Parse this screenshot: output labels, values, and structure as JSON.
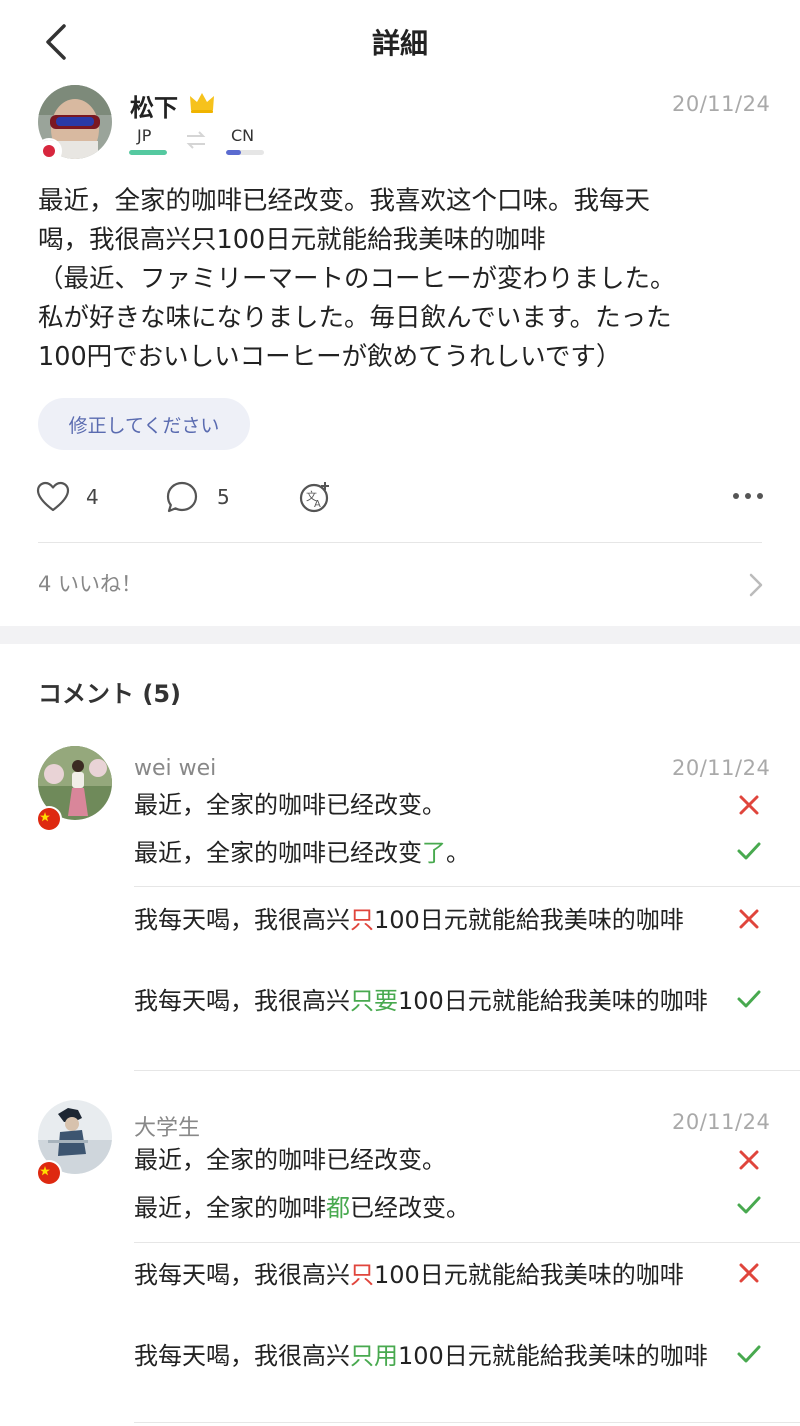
{
  "header": {
    "title": "詳細",
    "back_icon": "chevron-left-icon"
  },
  "post": {
    "author": "松下",
    "date": "20/11/24",
    "learning_lang": "JP",
    "native_lang": "CN",
    "lines": [
      "最近，全家的咖啡已经改变。我喜欢这个口味。我每天",
      "喝，我很高兴只100日元就能給我美味的咖啡",
      "（最近、ファミリーマートのコーヒーが変わりました。",
      "私が好きな味になりました。毎日飲んでいます。たった",
      "100円でおいしいコーヒーが飲めてうれしいです）"
    ],
    "correct_button": "修正してください",
    "like_count": "4",
    "comment_count": "5",
    "likes_text": "4 いいね！"
  },
  "comments": {
    "title": "コメント (5)",
    "items": [
      {
        "name": "wei wei",
        "date": "20/11/24",
        "blocks": [
          {
            "original": [
              {
                "t": "最近，全家的咖啡已经改变。"
              }
            ],
            "corrected": [
              {
                "t": "最近，全家的咖啡已经改变"
              },
              {
                "t": "了",
                "c": "green"
              },
              {
                "t": "。"
              }
            ]
          },
          {
            "original": [
              {
                "t": "我每天喝，我很高兴"
              },
              {
                "t": "只",
                "c": "red"
              },
              {
                "t": "100日元就能給我美味的咖啡"
              }
            ],
            "corrected": [
              {
                "t": "我每天喝，我很高兴"
              },
              {
                "t": "只要",
                "c": "green"
              },
              {
                "t": "100日元就能給我美味的咖啡"
              }
            ]
          }
        ]
      },
      {
        "name": "大学生",
        "date": "20/11/24",
        "blocks": [
          {
            "original": [
              {
                "t": "最近，全家的咖啡已经改变。"
              }
            ],
            "corrected": [
              {
                "t": "最近，全家的咖啡"
              },
              {
                "t": "都",
                "c": "green"
              },
              {
                "t": "已经改变。"
              }
            ]
          },
          {
            "original": [
              {
                "t": "我每天喝，我很高兴"
              },
              {
                "t": "只",
                "c": "red"
              },
              {
                "t": "100日元就能給我美味的咖啡"
              }
            ],
            "corrected": [
              {
                "t": "我每天喝，我很高兴"
              },
              {
                "t": "只用",
                "c": "green"
              },
              {
                "t": "100日元就能給我美味的咖啡"
              }
            ]
          }
        ]
      }
    ]
  },
  "colors": {
    "learning_bar": "#55c9a0",
    "native_bar": "#5b6bd0",
    "wrong": "#e0453c",
    "right": "#48a94f"
  }
}
